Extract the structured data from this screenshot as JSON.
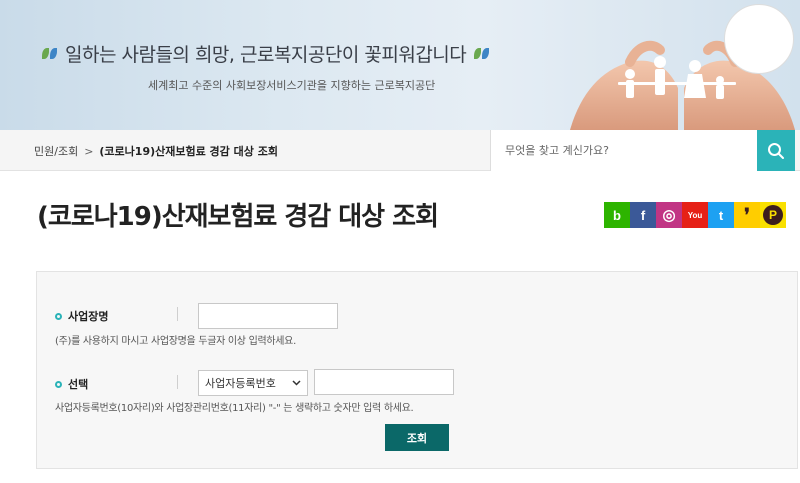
{
  "banner": {
    "slogan": "일하는 사람들의 희망, 근로복지공단이 꽃피워갑니다",
    "subtitle": "세계최고 수준의 사회보장서비스기관을 지향하는 근로복지공단"
  },
  "breadcrumb": {
    "parent": "민원/조회",
    "separator": ">",
    "current": "(코로나19)산재보험료 경감 대상 조회"
  },
  "search": {
    "placeholder": "무엇을 찾고 계신가요?"
  },
  "page": {
    "title": "(코로나19)산재보험료 경감 대상 조회"
  },
  "sns": [
    {
      "name": "blog",
      "label": "b",
      "color": "#2db400"
    },
    {
      "name": "facebook",
      "label": "f",
      "color": "#3b5998"
    },
    {
      "name": "instagram",
      "label": "◎",
      "color": "#c13584"
    },
    {
      "name": "youtube",
      "label": "You",
      "color": "#e62117"
    },
    {
      "name": "twitter",
      "label": "t",
      "color": "#1da1f2"
    },
    {
      "name": "kakaostory",
      "label": "❜",
      "color": "#ffcd00"
    },
    {
      "name": "kakaotalk",
      "label": "P",
      "color": "#f9e000"
    }
  ],
  "form": {
    "business_name": {
      "label": "사업장명",
      "value": "",
      "help": "(주)를 사용하지 마시고 사업장명을 두글자 이상 입력하세요."
    },
    "selection": {
      "label": "선택",
      "select_value": "사업자등록번호",
      "value": "",
      "help": "사업자등록번호(10자리)와 사업장관리번호(11자리) \"-\" 는 생략하고 숫자만 입력 하세요."
    },
    "submit_label": "조회"
  }
}
